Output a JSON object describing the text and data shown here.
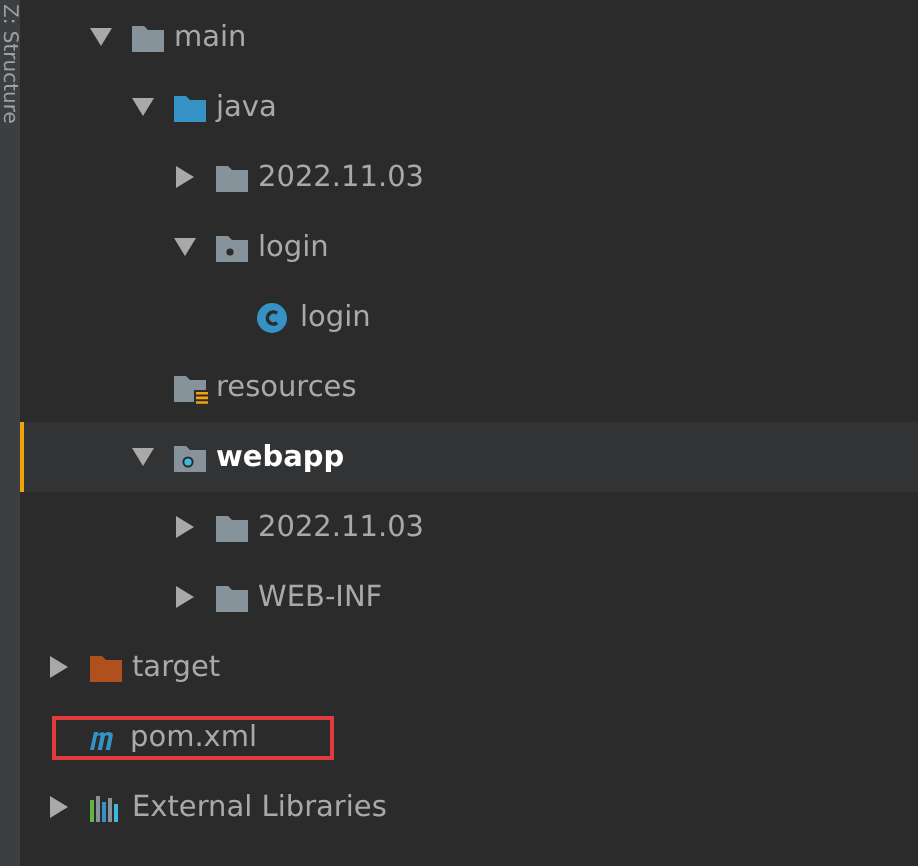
{
  "side_tab": {
    "label": "Z: Structure"
  },
  "tree": [
    {
      "children": [
        {
          "children": [
            {
              "label": "main",
              "kind": "folder",
              "expanded": true,
              "selected": false,
              "children": [
                {
                  "label": "java",
                  "kind": "source",
                  "expanded": true,
                  "selected": false,
                  "children": [
                    {
                      "label": "2022.11.03",
                      "kind": "folder",
                      "expanded": false,
                      "selected": false
                    },
                    {
                      "label": "login",
                      "kind": "package",
                      "expanded": true,
                      "selected": false,
                      "children": [
                        {
                          "label": "login",
                          "kind": "class",
                          "selected": false
                        }
                      ]
                    }
                  ]
                },
                {
                  "label": "resources",
                  "kind": "resources",
                  "selected": false
                },
                {
                  "label": "webapp",
                  "kind": "webapp",
                  "expanded": true,
                  "selected": true,
                  "children": [
                    {
                      "label": "2022.11.03",
                      "kind": "folder",
                      "expanded": false,
                      "selected": false
                    },
                    {
                      "label": "WEB-INF",
                      "kind": "folder",
                      "expanded": false,
                      "selected": false
                    }
                  ]
                }
              ]
            }
          ]
        },
        {
          "label": "target",
          "kind": "excluded",
          "expanded": false,
          "selected": false
        },
        {
          "label": "pom.xml",
          "kind": "maven",
          "selected": false,
          "highlighted": true
        }
      ]
    },
    {
      "label": "External Libraries",
      "kind": "libraries",
      "expanded": false,
      "selected": false
    }
  ]
}
